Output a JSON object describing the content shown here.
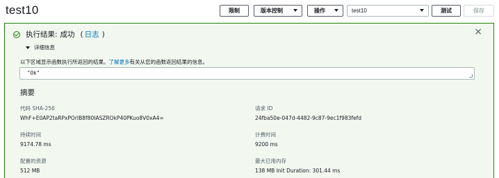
{
  "header": {
    "function_name": "test10",
    "limit_label": "限制",
    "version_label": "版本控制",
    "actions_label": "操作",
    "test_event_selected": "test10",
    "test_label": "测试",
    "save_label": "保存"
  },
  "result": {
    "title": "执行结果:",
    "status": "成功",
    "open_paren": "(",
    "log_link": "日志",
    "close_paren": ")",
    "status_color": "#1d8102",
    "details_label": "详细信息",
    "description_prefix": "以下区域显示函数执行所返回的结果。",
    "learn_more": "了解更多",
    "description_suffix": "有关从您的函数返回结果的信息。",
    "output_value": "\"Ok\""
  },
  "summary": {
    "title": "摘要",
    "code_sha_label": "代码 SHA-256",
    "code_sha_value": "WhF+E0AP2taRPxPOrIB8f80IASZROkP40PKuo8V0xA4=",
    "request_id_label": "请求 ID",
    "request_id_value": "24fba50e-047d-4482-9c87-9ec1f983fefd",
    "duration_label": "持续时间",
    "duration_value": "9174.78 ms",
    "billed_label": "计费时间",
    "billed_value": "9200 ms",
    "resources_label": "配置的资源",
    "resources_value": "512 MB",
    "max_memory_label": "最大已用内存",
    "max_memory_value": "138 MB Init Duration: 301.44 ms"
  }
}
